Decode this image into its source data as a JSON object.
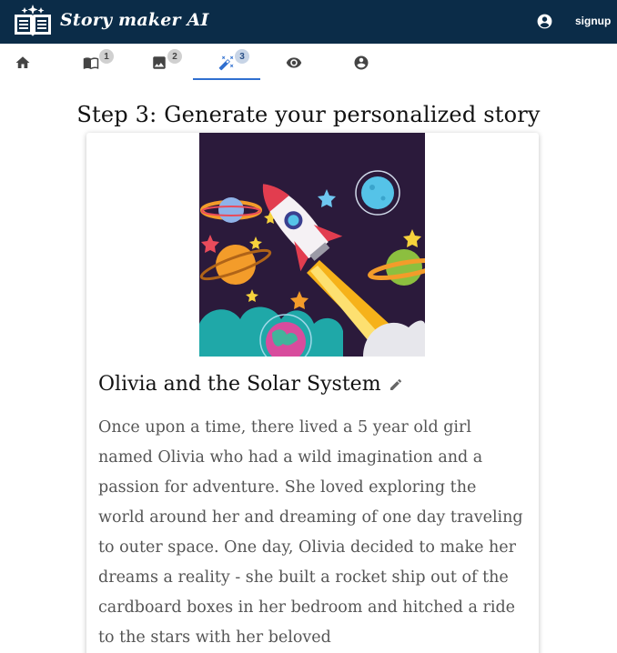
{
  "app": {
    "brand": "Story maker AI",
    "signup_label": "signup"
  },
  "icons": {
    "logo": "open-book-sparkles-icon",
    "account": "account-circle-icon",
    "home": "home-icon",
    "book": "book-icon",
    "image": "image-icon",
    "wand": "magic-wand-icon",
    "eye": "eye-icon",
    "profile": "account-circle-icon",
    "edit": "pencil-icon"
  },
  "tabs": [
    {
      "name": "home",
      "badge": ""
    },
    {
      "name": "book",
      "badge": "1"
    },
    {
      "name": "image",
      "badge": "2"
    },
    {
      "name": "generate",
      "badge": "3",
      "active": true
    },
    {
      "name": "preview",
      "badge": ""
    },
    {
      "name": "account",
      "badge": ""
    }
  ],
  "colors": {
    "appbar": "#0b2c48",
    "accent": "#2f6fd0"
  },
  "page": {
    "heading": "Step 3: Generate your personalized story"
  },
  "story": {
    "title": "Olivia and the Solar System",
    "text": "Once upon a time, there lived a 5 year old girl named Olivia who had a wild imagination and a passion for adventure. She loved exploring the world around her and dreaming of one day traveling to outer space. One day, Olivia decided to make her dreams a reality - she built a rocket ship out of the cardboard boxes in her bedroom and hitched a ride to the stars with her beloved"
  }
}
